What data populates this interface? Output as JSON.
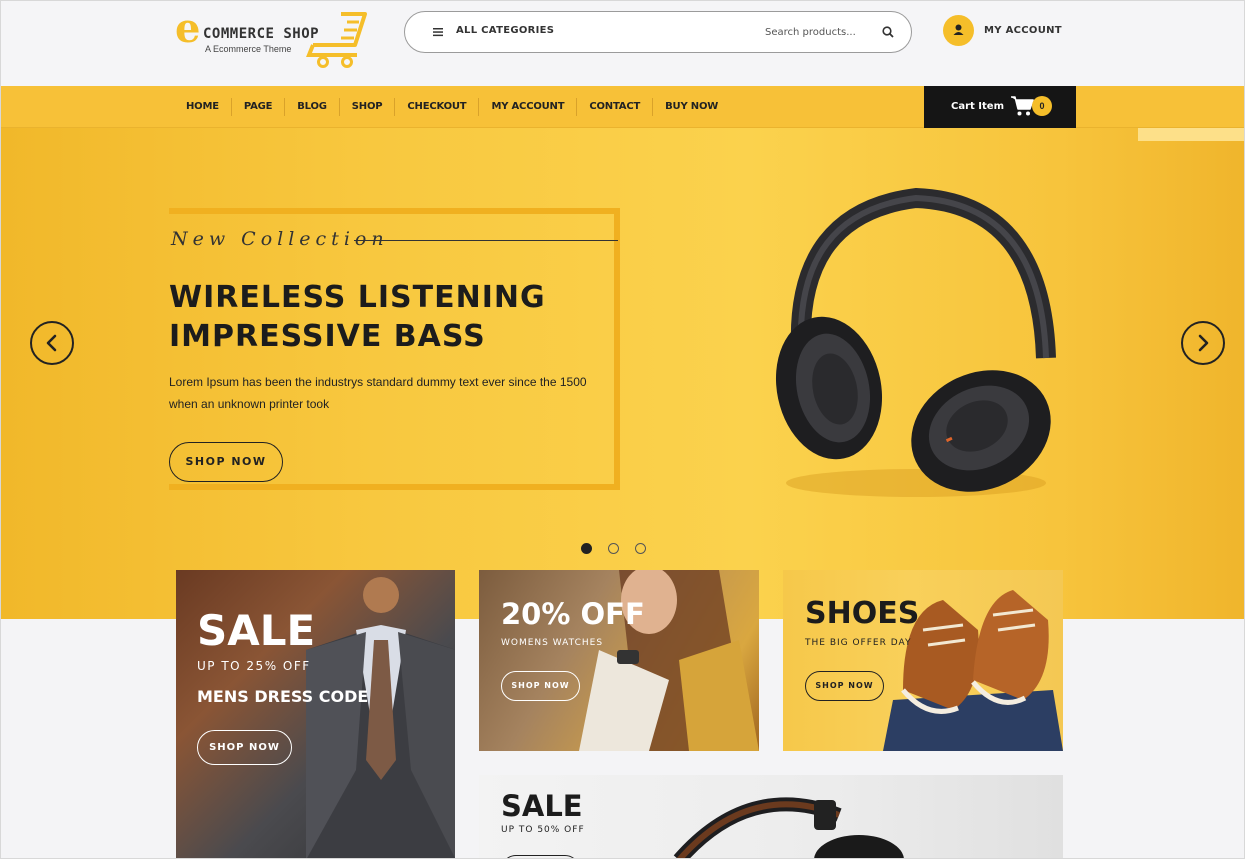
{
  "brand": {
    "logo_main": "COMMERCE SHOP",
    "logo_tagline": "A Ecommerce Theme",
    "accent_color": "#f7c138",
    "dark_color": "#151515"
  },
  "header": {
    "categories_label": "ALL CATEGORIES",
    "search_placeholder": "Search products...",
    "account_label": "MY ACCOUNT"
  },
  "nav": {
    "items": [
      "HOME",
      "PAGE",
      "BLOG",
      "SHOP",
      "CHECKOUT",
      "MY ACCOUNT",
      "CONTACT",
      "BUY NOW"
    ],
    "cart_label": "Cart Item",
    "cart_count": "0"
  },
  "hero": {
    "script": "New Collection",
    "title_line1": "WIRELESS LISTENING",
    "title_line2": "IMPRESSIVE BASS",
    "description": "Lorem Ipsum has been the industrys standard dummy text ever since the 1500 when an unknown printer took",
    "button": "SHOP NOW",
    "slides": 3,
    "active_slide": 1
  },
  "promos": {
    "sale": {
      "title": "SALE",
      "subtitle": "UP TO 25% OFF",
      "tagline": "MENS DRESS CODE",
      "button": "SHOP NOW"
    },
    "watches": {
      "title": "20% OFF",
      "subtitle": "WOMENS WATCHES",
      "button": "SHOP NOW"
    },
    "shoes": {
      "title": "SHOES",
      "subtitle": "THE BIG OFFER DAY",
      "button": "SHOP NOW"
    },
    "sale2": {
      "title": "SALE",
      "subtitle": "UP TO 50% OFF"
    }
  }
}
